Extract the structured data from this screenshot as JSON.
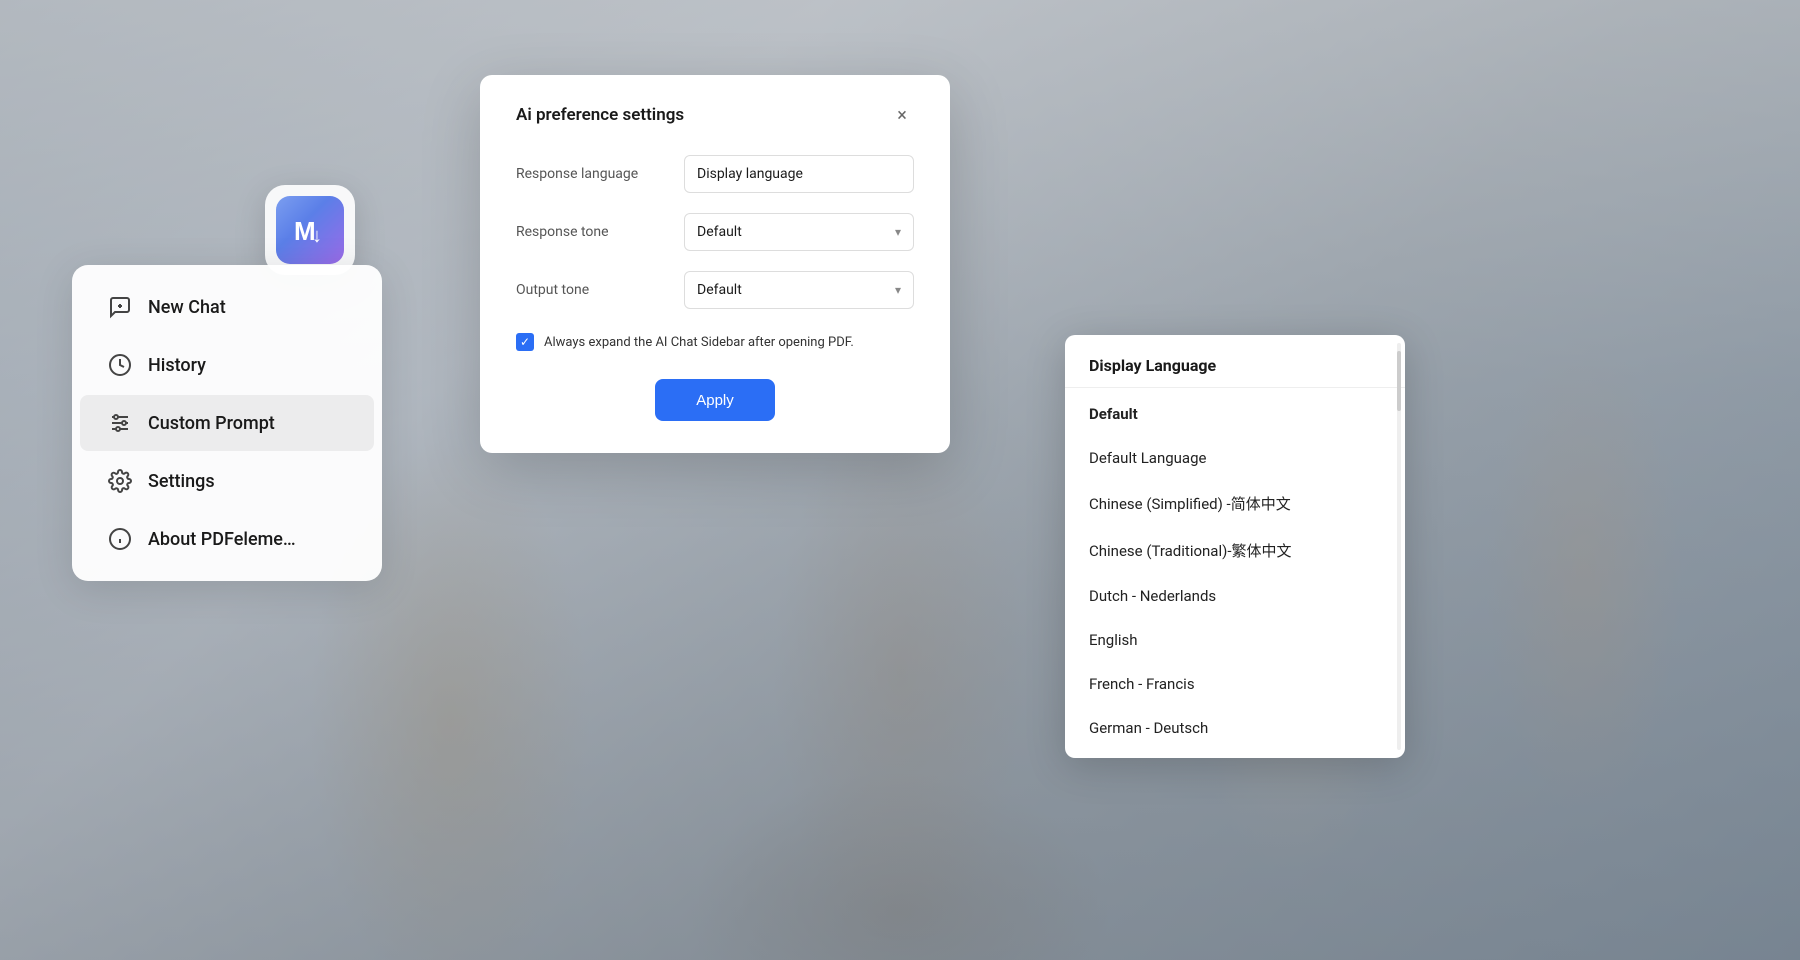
{
  "background": {
    "color1": "#b0b8c1",
    "color2": "#8090a0"
  },
  "app_icon": {
    "label": "M↓",
    "aria": "PDFelement app icon"
  },
  "menu": {
    "items": [
      {
        "id": "new-chat",
        "label": "New Chat",
        "icon": "chat-plus-icon"
      },
      {
        "id": "history",
        "label": "History",
        "icon": "clock-icon"
      },
      {
        "id": "custom-prompt",
        "label": "Custom Prompt",
        "icon": "sliders-icon",
        "active": true
      },
      {
        "id": "settings",
        "label": "Settings",
        "icon": "gear-icon"
      },
      {
        "id": "about",
        "label": "About PDFeleme…",
        "icon": "info-icon"
      }
    ]
  },
  "settings_dialog": {
    "title": "Ai preference settings",
    "close_label": "×",
    "fields": [
      {
        "id": "response-language",
        "label": "Response language",
        "value": "Display language"
      },
      {
        "id": "response-tone",
        "label": "Response tone",
        "value": "Default"
      },
      {
        "id": "output-tone",
        "label": "Output tone",
        "value": "Default"
      }
    ],
    "checkbox_label": "Always expand the AI Chat Sidebar after opening PDF.",
    "apply_button": "Apply"
  },
  "language_dropdown": {
    "header": "Display Language",
    "items": [
      {
        "id": "default",
        "label": "Default",
        "bold": true
      },
      {
        "id": "default-lang",
        "label": "Default Language",
        "bold": false
      },
      {
        "id": "chinese-simplified",
        "label": "Chinese (Simplified) -简体中文",
        "bold": false
      },
      {
        "id": "chinese-traditional",
        "label": "Chinese (Traditional)-繁体中文",
        "bold": false
      },
      {
        "id": "dutch",
        "label": "Dutch - Nederlands",
        "bold": false
      },
      {
        "id": "english",
        "label": "English",
        "bold": false
      },
      {
        "id": "french",
        "label": "French - Francis",
        "bold": false
      },
      {
        "id": "german",
        "label": "German - Deutsch",
        "bold": false
      }
    ]
  }
}
